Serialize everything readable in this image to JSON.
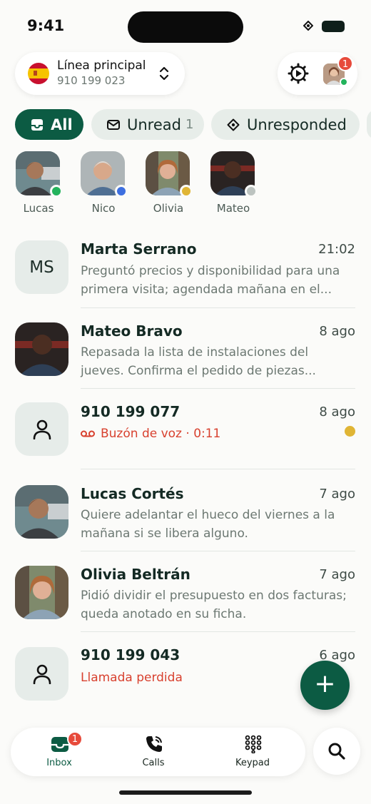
{
  "status_bar": {
    "time": "9:41"
  },
  "header": {
    "line_name": "Línea principal",
    "line_number": "910 199 023",
    "notification_count": "1"
  },
  "filters": [
    {
      "label": "All",
      "count": ""
    },
    {
      "label": "Unread",
      "count": "1"
    },
    {
      "label": "Unresponded",
      "count": ""
    }
  ],
  "recent_contacts": [
    {
      "name": "Lucas",
      "status_color": "#23b35c"
    },
    {
      "name": "Nico",
      "status_color": "#3d6fe0"
    },
    {
      "name": "Olivia",
      "status_color": "#e0b535"
    },
    {
      "name": "Mateo",
      "status_color": "#bcc3c0"
    }
  ],
  "conversations": [
    {
      "title": "Marta Serrano",
      "initials": "MS",
      "time": "21:02",
      "preview": "Preguntó precios y disponibilidad para una primera visita; agendada mañana en el..."
    },
    {
      "title": "Mateo Bravo",
      "time": "8 ago",
      "preview": "Repasada la lista de instalaciones del jueves. Confirma el pedido de piezas..."
    },
    {
      "title": "910 199 077",
      "time": "8 ago",
      "preview": "Buzón de voz · 0:11"
    },
    {
      "title": "Lucas Cortés",
      "time": "7 ago",
      "preview": "Quiere adelantar el hueco del viernes a la mañana si se libera alguno."
    },
    {
      "title": "Olivia Beltrán",
      "time": "7 ago",
      "preview": "Pidió dividir el presupuesto en dos facturas; queda anotado en su ficha."
    },
    {
      "title": "910 199 043",
      "time": "6 ago",
      "preview": "Llamada perdida"
    }
  ],
  "tabs": [
    {
      "label": "Inbox",
      "badge": "1"
    },
    {
      "label": "Calls"
    },
    {
      "label": "Keypad"
    }
  ],
  "colors": {
    "brand": "#0c5b43",
    "missed": "#d8412f",
    "badge": "#e74a3b"
  }
}
